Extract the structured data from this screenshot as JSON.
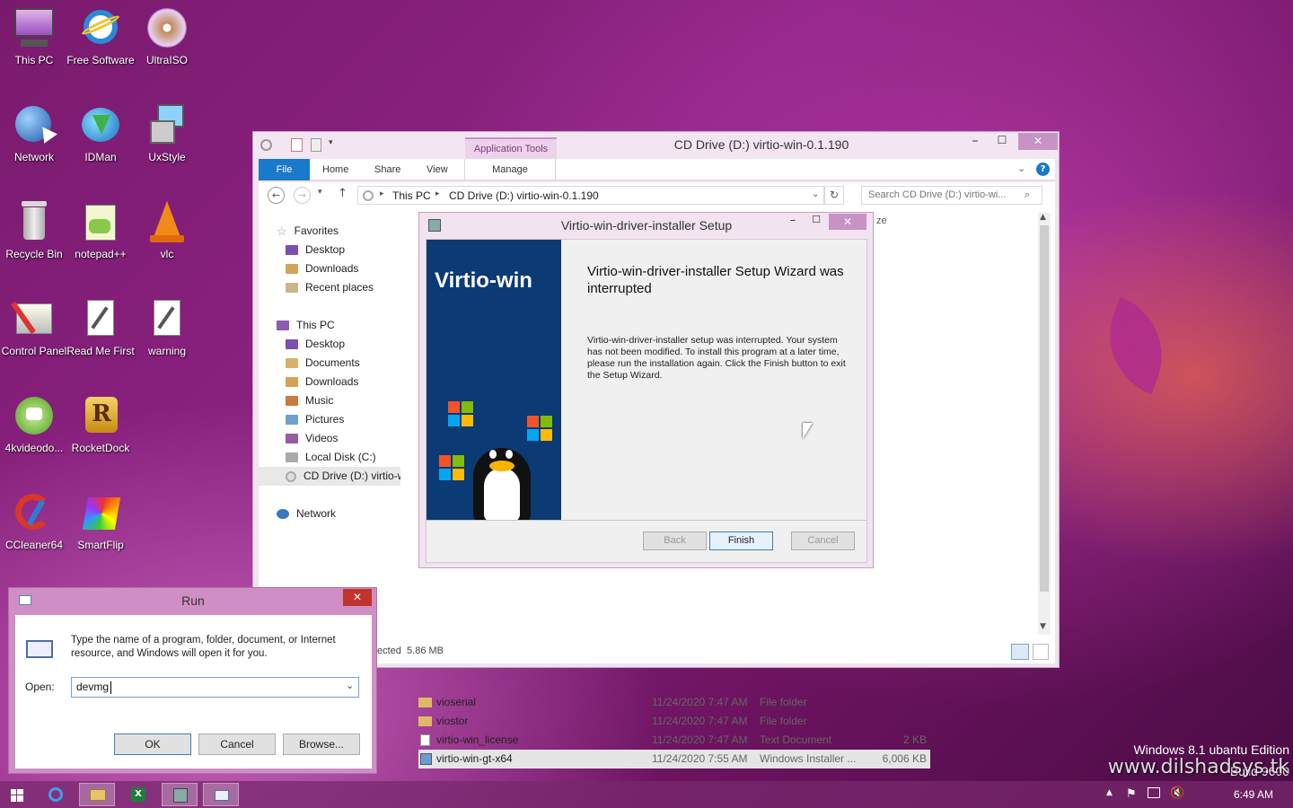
{
  "desktop": {
    "icons": [
      {
        "label": "This PC"
      },
      {
        "label": "Free Software"
      },
      {
        "label": "UltraISO"
      },
      {
        "label": "Network"
      },
      {
        "label": "IDMan"
      },
      {
        "label": "UxStyle"
      },
      {
        "label": "Recycle Bin"
      },
      {
        "label": "notepad++"
      },
      {
        "label": "vlc"
      },
      {
        "label": "Control Panel"
      },
      {
        "label": "Read Me First"
      },
      {
        "label": "warning"
      },
      {
        "label": "4kvideodo..."
      },
      {
        "label": "RocketDock"
      },
      {
        "label": "CCleaner64"
      },
      {
        "label": "SmartFlip"
      }
    ],
    "watermark": {
      "edition": "Windows 8.1 ubantu Edition",
      "build": "Build 9600",
      "site": "www.dilshadsys.tk"
    }
  },
  "explorer": {
    "title": "CD Drive (D:) virtio-win-0.1.190",
    "context_tab": "Application Tools",
    "tabs": {
      "file": "File",
      "home": "Home",
      "share": "Share",
      "view": "View",
      "manage": "Manage"
    },
    "address": {
      "root": "This PC",
      "path": "CD Drive (D:) virtio-win-0.1.190"
    },
    "search_placeholder": "Search CD Drive (D:) virtio-wi...",
    "header_partial": "ze",
    "nav": {
      "favorites": "Favorites",
      "fav_items": [
        "Desktop",
        "Downloads",
        "Recent places"
      ],
      "thispc": "This PC",
      "pc_items": [
        "Desktop",
        "Documents",
        "Downloads",
        "Music",
        "Pictures",
        "Videos",
        "Local Disk (C:)",
        "CD Drive (D:) virtio-w"
      ],
      "network": "Network"
    },
    "files": [
      {
        "name": "vioserial",
        "date": "11/24/2020 7:47 AM",
        "type": "File folder",
        "size": ""
      },
      {
        "name": "viostor",
        "date": "11/24/2020 7:47 AM",
        "type": "File folder",
        "size": ""
      },
      {
        "name": "virtio-win_license",
        "date": "11/24/2020 7:47 AM",
        "type": "Text Document",
        "size": "2 KB"
      },
      {
        "name": "virtio-win-gt-x64",
        "date": "11/24/2020 7:55 AM",
        "type": "Windows Installer ...",
        "size": "6,006 KB"
      }
    ],
    "status": "ected  5.86 MB"
  },
  "setup": {
    "title": "Virtio-win-driver-installer Setup",
    "banner_text": "Virtio-win",
    "heading": "Virtio-win-driver-installer Setup Wizard was interrupted",
    "body": "Virtio-win-driver-installer setup was interrupted. Your system has not been modified. To install this program at a later time, please run the installation again. Click the Finish button to exit the Setup Wizard.",
    "buttons": {
      "back": "Back",
      "finish": "Finish",
      "cancel": "Cancel"
    }
  },
  "run": {
    "title": "Run",
    "description": "Type the name of a program, folder, document, or Internet resource, and Windows will open it for you.",
    "open_label": "Open:",
    "open_value": "devmg",
    "buttons": {
      "ok": "OK",
      "cancel": "Cancel",
      "browse": "Browse..."
    }
  },
  "taskbar": {
    "clock": "6:49 AM"
  },
  "colors": {
    "accent_blue": "#1979ca",
    "setup_banner": "#0b3a75"
  }
}
